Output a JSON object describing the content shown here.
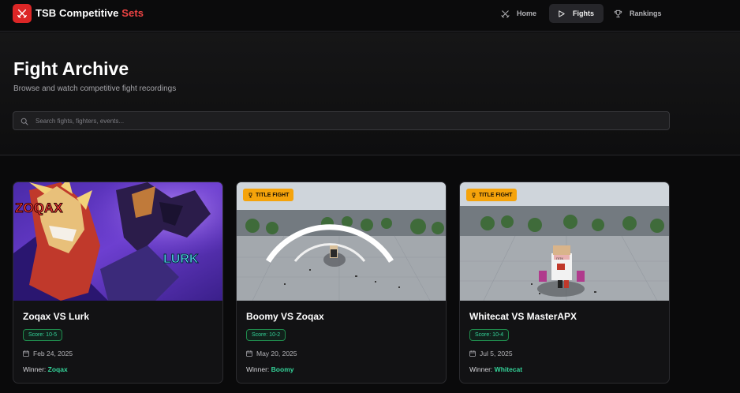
{
  "nav": {
    "brand_main": "TSB Competitive",
    "brand_accent": "Sets",
    "links": [
      {
        "label": "Home",
        "icon": "swords-icon",
        "active": false
      },
      {
        "label": "Fights",
        "icon": "play-icon",
        "active": true
      },
      {
        "label": "Rankings",
        "icon": "trophy-icon",
        "active": false
      }
    ]
  },
  "hero": {
    "title": "Fight Archive",
    "subtitle": "Browse and watch competitive fight recordings",
    "search_placeholder": "Search fights, fighters, events..."
  },
  "cards": [
    {
      "title": "Zoqax VS Lurk",
      "score": "Score: 10-5",
      "date": "Feb 24, 2025",
      "winner_label": "Winner:",
      "winner": "Zoqax",
      "title_fight": false,
      "badge": "",
      "art_left": "ZOQAX",
      "art_right": "LURK"
    },
    {
      "title": "Boomy VS Zoqax",
      "score": "Score: 10-2",
      "date": "May 20, 2025",
      "winner_label": "Winner:",
      "winner": "Boomy",
      "title_fight": true,
      "badge": "TITLE FIGHT"
    },
    {
      "title": "Whitecat VS MasterAPX",
      "score": "Score: 10-4",
      "date": "Jul 5, 2025",
      "winner_label": "Winner:",
      "winner": "Whitecat",
      "title_fight": true,
      "badge": "TITLE FIGHT"
    }
  ],
  "colors": {
    "accent": "#dc2626",
    "score": "#34d399",
    "badge": "#f5a30b"
  }
}
